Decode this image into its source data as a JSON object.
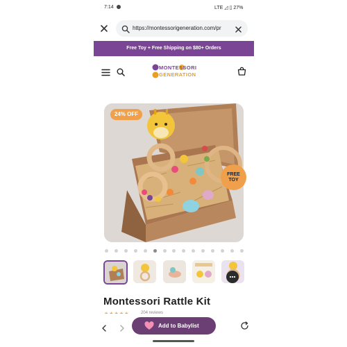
{
  "status_bar": {
    "time": "7:14",
    "right": "LTE ◿ ▯ 27%"
  },
  "browser": {
    "url": "https://montessorigeneration.com/pr"
  },
  "promo_banner": {
    "text": "Free Toy + Free Shipping on $80+ Orders"
  },
  "header": {
    "logo_line1": "MONTESSORI",
    "logo_line2": "GENERATION"
  },
  "product": {
    "discount_badge": "24% OFF",
    "free_badge_line1": "FREE",
    "free_badge_line2": "TOY",
    "title": "Montessori Rattle Kit",
    "rating_stars": "★★★★★",
    "review_count": "204 reviews",
    "carousel_total": 15,
    "carousel_active_index": 5
  },
  "bottom_bar": {
    "cta_label": "Add to Babylist"
  },
  "colors": {
    "brand_purple": "#7b4596",
    "cta_purple": "#6b3e74",
    "badge_orange": "#f0a04b"
  }
}
